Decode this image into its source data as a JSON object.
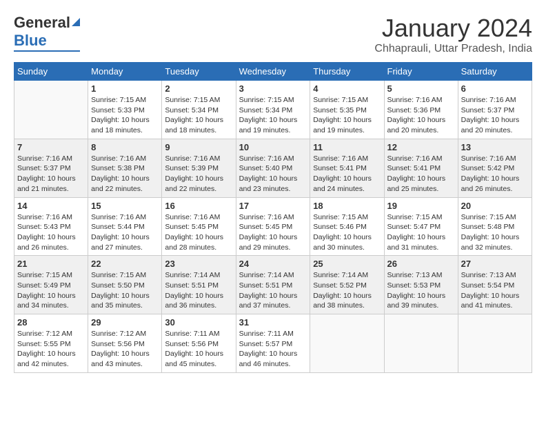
{
  "header": {
    "logo_general": "General",
    "logo_blue": "Blue",
    "month_title": "January 2024",
    "location": "Chhaprauli, Uttar Pradesh, India"
  },
  "days_of_week": [
    "Sunday",
    "Monday",
    "Tuesday",
    "Wednesday",
    "Thursday",
    "Friday",
    "Saturday"
  ],
  "weeks": [
    [
      {
        "day": "",
        "info": ""
      },
      {
        "day": "1",
        "info": "Sunrise: 7:15 AM\nSunset: 5:33 PM\nDaylight: 10 hours\nand 18 minutes."
      },
      {
        "day": "2",
        "info": "Sunrise: 7:15 AM\nSunset: 5:34 PM\nDaylight: 10 hours\nand 18 minutes."
      },
      {
        "day": "3",
        "info": "Sunrise: 7:15 AM\nSunset: 5:34 PM\nDaylight: 10 hours\nand 19 minutes."
      },
      {
        "day": "4",
        "info": "Sunrise: 7:15 AM\nSunset: 5:35 PM\nDaylight: 10 hours\nand 19 minutes."
      },
      {
        "day": "5",
        "info": "Sunrise: 7:16 AM\nSunset: 5:36 PM\nDaylight: 10 hours\nand 20 minutes."
      },
      {
        "day": "6",
        "info": "Sunrise: 7:16 AM\nSunset: 5:37 PM\nDaylight: 10 hours\nand 20 minutes."
      }
    ],
    [
      {
        "day": "7",
        "info": "Sunrise: 7:16 AM\nSunset: 5:37 PM\nDaylight: 10 hours\nand 21 minutes."
      },
      {
        "day": "8",
        "info": "Sunrise: 7:16 AM\nSunset: 5:38 PM\nDaylight: 10 hours\nand 22 minutes."
      },
      {
        "day": "9",
        "info": "Sunrise: 7:16 AM\nSunset: 5:39 PM\nDaylight: 10 hours\nand 22 minutes."
      },
      {
        "day": "10",
        "info": "Sunrise: 7:16 AM\nSunset: 5:40 PM\nDaylight: 10 hours\nand 23 minutes."
      },
      {
        "day": "11",
        "info": "Sunrise: 7:16 AM\nSunset: 5:41 PM\nDaylight: 10 hours\nand 24 minutes."
      },
      {
        "day": "12",
        "info": "Sunrise: 7:16 AM\nSunset: 5:41 PM\nDaylight: 10 hours\nand 25 minutes."
      },
      {
        "day": "13",
        "info": "Sunrise: 7:16 AM\nSunset: 5:42 PM\nDaylight: 10 hours\nand 26 minutes."
      }
    ],
    [
      {
        "day": "14",
        "info": "Sunrise: 7:16 AM\nSunset: 5:43 PM\nDaylight: 10 hours\nand 26 minutes."
      },
      {
        "day": "15",
        "info": "Sunrise: 7:16 AM\nSunset: 5:44 PM\nDaylight: 10 hours\nand 27 minutes."
      },
      {
        "day": "16",
        "info": "Sunrise: 7:16 AM\nSunset: 5:45 PM\nDaylight: 10 hours\nand 28 minutes."
      },
      {
        "day": "17",
        "info": "Sunrise: 7:16 AM\nSunset: 5:45 PM\nDaylight: 10 hours\nand 29 minutes."
      },
      {
        "day": "18",
        "info": "Sunrise: 7:15 AM\nSunset: 5:46 PM\nDaylight: 10 hours\nand 30 minutes."
      },
      {
        "day": "19",
        "info": "Sunrise: 7:15 AM\nSunset: 5:47 PM\nDaylight: 10 hours\nand 31 minutes."
      },
      {
        "day": "20",
        "info": "Sunrise: 7:15 AM\nSunset: 5:48 PM\nDaylight: 10 hours\nand 32 minutes."
      }
    ],
    [
      {
        "day": "21",
        "info": "Sunrise: 7:15 AM\nSunset: 5:49 PM\nDaylight: 10 hours\nand 34 minutes."
      },
      {
        "day": "22",
        "info": "Sunrise: 7:15 AM\nSunset: 5:50 PM\nDaylight: 10 hours\nand 35 minutes."
      },
      {
        "day": "23",
        "info": "Sunrise: 7:14 AM\nSunset: 5:51 PM\nDaylight: 10 hours\nand 36 minutes."
      },
      {
        "day": "24",
        "info": "Sunrise: 7:14 AM\nSunset: 5:51 PM\nDaylight: 10 hours\nand 37 minutes."
      },
      {
        "day": "25",
        "info": "Sunrise: 7:14 AM\nSunset: 5:52 PM\nDaylight: 10 hours\nand 38 minutes."
      },
      {
        "day": "26",
        "info": "Sunrise: 7:13 AM\nSunset: 5:53 PM\nDaylight: 10 hours\nand 39 minutes."
      },
      {
        "day": "27",
        "info": "Sunrise: 7:13 AM\nSunset: 5:54 PM\nDaylight: 10 hours\nand 41 minutes."
      }
    ],
    [
      {
        "day": "28",
        "info": "Sunrise: 7:12 AM\nSunset: 5:55 PM\nDaylight: 10 hours\nand 42 minutes."
      },
      {
        "day": "29",
        "info": "Sunrise: 7:12 AM\nSunset: 5:56 PM\nDaylight: 10 hours\nand 43 minutes."
      },
      {
        "day": "30",
        "info": "Sunrise: 7:11 AM\nSunset: 5:56 PM\nDaylight: 10 hours\nand 45 minutes."
      },
      {
        "day": "31",
        "info": "Sunrise: 7:11 AM\nSunset: 5:57 PM\nDaylight: 10 hours\nand 46 minutes."
      },
      {
        "day": "",
        "info": ""
      },
      {
        "day": "",
        "info": ""
      },
      {
        "day": "",
        "info": ""
      }
    ]
  ]
}
